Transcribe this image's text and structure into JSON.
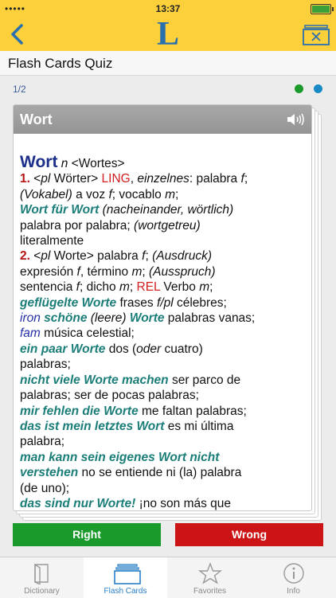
{
  "status_bar": {
    "carrier": "•••••",
    "time": "13:37"
  },
  "nav": {
    "logo": "L",
    "back_icon": "chevron-left-icon",
    "box_icon": "flashcard-box-icon"
  },
  "page": {
    "title": "Flash Cards Quiz"
  },
  "quiz": {
    "progress": "1/2"
  },
  "card": {
    "header_word": "Wort",
    "speaker_icon": "speaker-icon",
    "headword": "Wort",
    "line1": [
      {
        "t": "Wort",
        "c": "hw"
      },
      {
        "t": " ",
        "c": ""
      },
      {
        "t": "n",
        "c": "it"
      },
      {
        "t": " <Wortes>",
        "c": ""
      }
    ]
  },
  "entry_lines": [
    [
      {
        "t": "Wort",
        "c": "hw"
      },
      {
        "t": " ",
        "c": ""
      },
      {
        "t": "n",
        "c": "it"
      },
      {
        "t": " <Wortes>",
        "c": ""
      }
    ],
    [
      {
        "t": "1.",
        "c": "num"
      },
      {
        "t": " <",
        "c": ""
      },
      {
        "t": "pl",
        "c": "it"
      },
      {
        "t": " Wörter> ",
        "c": ""
      },
      {
        "t": "LING",
        "c": "red"
      },
      {
        "t": ", ",
        "c": ""
      },
      {
        "t": "einzelnes",
        "c": "it"
      },
      {
        "t": ": palabra ",
        "c": ""
      },
      {
        "t": "f",
        "c": "it"
      },
      {
        "t": ";",
        "c": ""
      }
    ],
    [
      {
        "t": "(Vokabel)",
        "c": "it"
      },
      {
        "t": " a voz ",
        "c": ""
      },
      {
        "t": "f",
        "c": "it"
      },
      {
        "t": "; vocablo ",
        "c": ""
      },
      {
        "t": "m",
        "c": "it"
      },
      {
        "t": ";",
        "c": ""
      }
    ],
    [
      {
        "t": "Wort für Wort",
        "c": "ex"
      },
      {
        "t": " ",
        "c": ""
      },
      {
        "t": "(nacheinander, wörtlich)",
        "c": "it"
      }
    ],
    [
      {
        "t": "palabra por palabra; ",
        "c": ""
      },
      {
        "t": "(wortgetreu)",
        "c": "it"
      }
    ],
    [
      {
        "t": "literalmente",
        "c": ""
      }
    ],
    [
      {
        "t": "2.",
        "c": "num"
      },
      {
        "t": " <",
        "c": ""
      },
      {
        "t": "pl",
        "c": "it"
      },
      {
        "t": " Worte> palabra ",
        "c": ""
      },
      {
        "t": "f",
        "c": "it"
      },
      {
        "t": "; ",
        "c": ""
      },
      {
        "t": "(Ausdruck)",
        "c": "it"
      }
    ],
    [
      {
        "t": "expresión ",
        "c": ""
      },
      {
        "t": "f",
        "c": "it"
      },
      {
        "t": ", término ",
        "c": ""
      },
      {
        "t": "m",
        "c": "it"
      },
      {
        "t": "; ",
        "c": ""
      },
      {
        "t": "(Ausspruch)",
        "c": "it"
      }
    ],
    [
      {
        "t": "sentencia ",
        "c": ""
      },
      {
        "t": "f",
        "c": "it"
      },
      {
        "t": "; dicho ",
        "c": ""
      },
      {
        "t": "m",
        "c": "it"
      },
      {
        "t": "; ",
        "c": ""
      },
      {
        "t": "REL",
        "c": "red"
      },
      {
        "t": " Verbo ",
        "c": ""
      },
      {
        "t": "m",
        "c": "it"
      },
      {
        "t": ";",
        "c": ""
      }
    ],
    [
      {
        "t": "geflügelte Worte",
        "c": "ex"
      },
      {
        "t": " frases ",
        "c": ""
      },
      {
        "t": "f/pl",
        "c": "it"
      },
      {
        "t": " célebres;",
        "c": ""
      }
    ],
    [
      {
        "t": "iron",
        "c": "blue"
      },
      {
        "t": " ",
        "c": ""
      },
      {
        "t": "schöne",
        "c": "ex"
      },
      {
        "t": " ",
        "c": ""
      },
      {
        "t": "(leere)",
        "c": "it"
      },
      {
        "t": " ",
        "c": ""
      },
      {
        "t": "Worte",
        "c": "ex"
      },
      {
        "t": " palabras vanas;",
        "c": ""
      }
    ],
    [
      {
        "t": "fam",
        "c": "blue"
      },
      {
        "t": " música celestial;",
        "c": ""
      }
    ],
    [
      {
        "t": "ein paar Worte",
        "c": "ex"
      },
      {
        "t": " dos (",
        "c": ""
      },
      {
        "t": "oder",
        "c": "it"
      },
      {
        "t": " cuatro)",
        "c": ""
      }
    ],
    [
      {
        "t": "palabras;",
        "c": ""
      }
    ],
    [
      {
        "t": "nicht viele Worte machen",
        "c": "ex"
      },
      {
        "t": " ser parco de",
        "c": ""
      }
    ],
    [
      {
        "t": "palabras; ser de pocas palabras;",
        "c": ""
      }
    ],
    [
      {
        "t": "mir fehlen die Worte",
        "c": "ex"
      },
      {
        "t": " me faltan palabras;",
        "c": ""
      }
    ],
    [
      {
        "t": "das ist mein letztes Wort",
        "c": "ex"
      },
      {
        "t": " es mi última",
        "c": ""
      }
    ],
    [
      {
        "t": "palabra;",
        "c": ""
      }
    ],
    [
      {
        "t": "man kann sein eigenes Wort nicht",
        "c": "ex"
      }
    ],
    [
      {
        "t": "verstehen",
        "c": "ex"
      },
      {
        "t": " no se entiende ni (la) palabra",
        "c": ""
      }
    ],
    [
      {
        "t": "(de uno);",
        "c": ""
      }
    ],
    [
      {
        "t": "das sind nur Worte!",
        "c": "ex"
      },
      {
        "t": " ¡no son más que",
        "c": ""
      }
    ]
  ],
  "buttons": {
    "right": "Right",
    "wrong": "Wrong"
  },
  "tabs": [
    {
      "label": "Dictionary",
      "icon": "book-icon",
      "active": false
    },
    {
      "label": "Flash Cards",
      "icon": "flashcards-icon",
      "active": true
    },
    {
      "label": "Favorites",
      "icon": "star-icon",
      "active": false
    },
    {
      "label": "Info",
      "icon": "info-icon",
      "active": false
    }
  ],
  "colors": {
    "brand_yellow": "#fcd03a",
    "brand_blue": "#2a6fae",
    "right_green": "#1a9a2a",
    "wrong_red": "#cc1417"
  }
}
